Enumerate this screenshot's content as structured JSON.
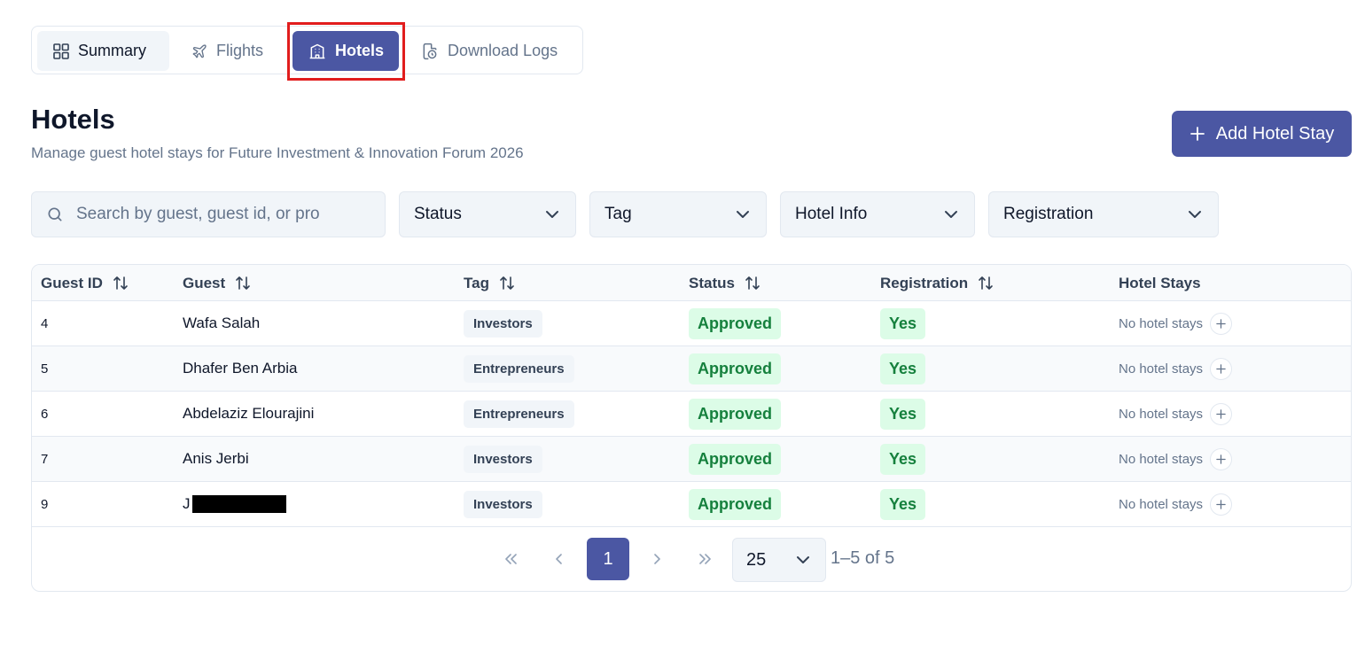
{
  "tabs": [
    {
      "label": "Summary",
      "icon": "grid-icon",
      "active": false
    },
    {
      "label": "Flights",
      "icon": "plane-icon",
      "active": false
    },
    {
      "label": "Hotels",
      "icon": "hotel-icon",
      "active": true
    },
    {
      "label": "Download Logs",
      "icon": "file-clock-icon",
      "active": false
    }
  ],
  "header": {
    "title": "Hotels",
    "subtitle": "Manage guest hotel stays for Future Investment & Innovation Forum 2026",
    "add_button": "Add Hotel Stay"
  },
  "filters": {
    "search_placeholder": "Search by guest, guest id, or pro",
    "status": "Status",
    "tag": "Tag",
    "hotel_info": "Hotel Info",
    "registration": "Registration"
  },
  "table": {
    "columns": [
      "Guest ID",
      "Guest",
      "Tag",
      "Status",
      "Registration",
      "Hotel Stays"
    ],
    "rows": [
      {
        "id": "4",
        "guest": "Wafa Salah",
        "tag": "Investors",
        "status": "Approved",
        "registration": "Yes",
        "stays": "No hotel stays"
      },
      {
        "id": "5",
        "guest": "Dhafer Ben Arbia",
        "tag": "Entrepreneurs",
        "status": "Approved",
        "registration": "Yes",
        "stays": "No hotel stays"
      },
      {
        "id": "6",
        "guest": "Abdelaziz Elourajini",
        "tag": "Entrepreneurs",
        "status": "Approved",
        "registration": "Yes",
        "stays": "No hotel stays"
      },
      {
        "id": "7",
        "guest": "Anis Jerbi",
        "tag": "Investors",
        "status": "Approved",
        "registration": "Yes",
        "stays": "No hotel stays"
      },
      {
        "id": "9",
        "guest": "J",
        "guest_redacted": true,
        "tag": "Investors",
        "status": "Approved",
        "registration": "Yes",
        "stays": "No hotel stays"
      }
    ]
  },
  "pagination": {
    "current_page": "1",
    "page_size": "25",
    "range": "1–5 of 5"
  },
  "colors": {
    "accent": "#4b57a3",
    "success_bg": "#dcfce7",
    "success_text": "#15803d",
    "highlight": "#e11d1d"
  }
}
